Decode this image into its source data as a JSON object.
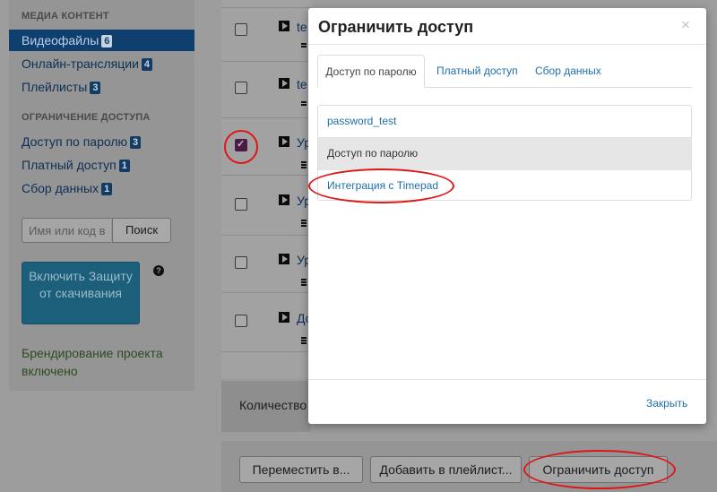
{
  "sidebar": {
    "media_heading": "МЕДИА КОНТЕНТ",
    "media_items": [
      {
        "label": "Видеофайлы",
        "count": "6",
        "active": true
      },
      {
        "label": "Онлайн-трансляции",
        "count": "4"
      },
      {
        "label": "Плейлисты",
        "count": "3"
      }
    ],
    "access_heading": "ОГРАНИЧЕНИЕ ДОСТУПА",
    "access_items": [
      {
        "label": "Доступ по паролю",
        "count": "3"
      },
      {
        "label": "Платный доступ",
        "count": "1"
      },
      {
        "label": "Сбор данных",
        "count": "1"
      }
    ],
    "search": {
      "placeholder": "Имя или код в",
      "button": "Поиск"
    },
    "protect_button": "Включить Защиту от скачивания",
    "help_icon": "?",
    "branding_status": "Брендирование проекта включено"
  },
  "video_list": {
    "rows": [
      {
        "title_fragment": "te",
        "checked": false
      },
      {
        "title_fragment": "te",
        "checked": false
      },
      {
        "title_fragment": "Ур",
        "checked": true
      },
      {
        "title_fragment": "Ур",
        "checked": false
      },
      {
        "title_fragment": "Ур",
        "checked": false
      },
      {
        "title_fragment": "До",
        "checked": false
      }
    ],
    "count_label": "Количество"
  },
  "footer": {
    "move_button": "Переместить в...",
    "add_playlist_button": "Добавить в плейлист...",
    "restrict_button": "Ограничить доступ"
  },
  "modal": {
    "title": "Ограничить доступ",
    "close_symbol": "×",
    "tabs": [
      {
        "label": "Доступ по паролю",
        "active": true
      },
      {
        "label": "Платный доступ"
      },
      {
        "label": "Сбор данных"
      }
    ],
    "options": [
      {
        "label": "password_test"
      },
      {
        "label": "Доступ по паролю",
        "active": true
      },
      {
        "label": "Интеграция с Timepad"
      }
    ],
    "close_link": "Закрыть"
  },
  "colors": {
    "annotation": "#e01616",
    "link": "#1d6fad",
    "overlay": "#9d9d9d"
  }
}
